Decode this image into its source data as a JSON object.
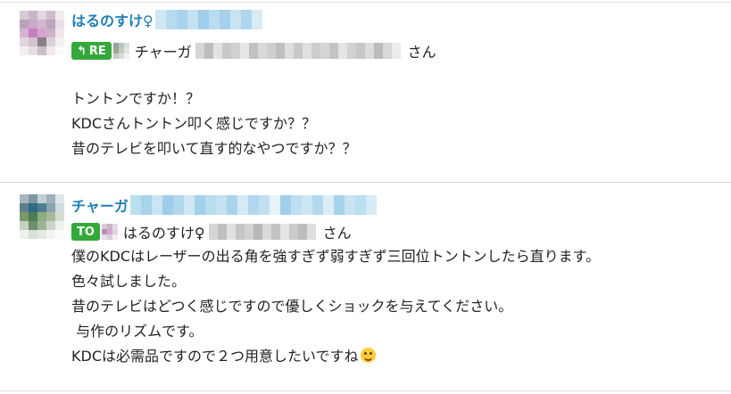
{
  "colors": {
    "name_link": "#1f7fb8",
    "tag_green": "#35a83b",
    "divider": "#dcdcdc",
    "text": "#222222"
  },
  "messages": [
    {
      "sender_name": "はるのすけ♀",
      "tag_label": "RE",
      "tag_icon": "reply-arrow-icon",
      "addressee_prefix": "チャーガ",
      "addressee_suffix": "さん",
      "lines": [
        "トントンですか！？",
        "KDCさんトントン叩く感じですか？？",
        "昔のテレビを叩いて直す的なやつですか？？"
      ]
    },
    {
      "sender_name": "チャーガ",
      "tag_label": "TO",
      "addressee_prefix": "はるのすけ♀",
      "addressee_suffix": "さん",
      "lines": [
        "僕のKDCはレーザーの出る角を強すぎず弱すぎず三回位トントンしたら直ります。",
        "色々試しました。",
        "昔のテレビはどつく感じですので優しくショックを与えてください。",
        " 与作のリズムです。",
        "KDCは必需品ですので２つ用意したいですね"
      ],
      "emoji": "smiling-face-emoji"
    }
  ]
}
